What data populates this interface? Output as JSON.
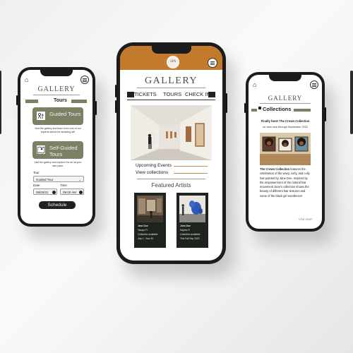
{
  "colors": {
    "olive": "#7e8064",
    "dark_green": "#1f231e",
    "rust_header": "#c47a2c",
    "accent_line": "#c98a53"
  },
  "tours_screen": {
    "gallery_title": "GALLERY",
    "section_title": "Tours",
    "guided": {
      "label": "Guided Tours",
      "icon": "tour-guide-icon",
      "caption": "Visit the gallery and learn from one of our experts about the amazing art!"
    },
    "self_guided": {
      "label": "Self-Guided Tours",
      "icon": "map-icon",
      "caption": "Visit the gallery and explore the art at your own pace."
    },
    "tour_label": "Tour",
    "tour_value": "Guided Tour",
    "date_label": "Date",
    "date_value": "08/20/22",
    "time_label": "Time",
    "time_value": "09:00 AM",
    "schedule_button": "Schedule"
  },
  "home_screen": {
    "logo_text": "SFA",
    "gallery_title": "GALLERY",
    "nav": [
      "TICKETS",
      "TOURS",
      "CHECK IN"
    ],
    "links": [
      "Upcoming Events",
      "View collections"
    ],
    "featured_title": "Featured Artists",
    "artists": [
      {
        "name": "Jane Doe",
        "location": "Tampa Fl",
        "status": "Collection available",
        "dates": "July 1 - Nov 30"
      },
      {
        "name": "John Doe",
        "location": "Naples Fl",
        "status": "Collection available",
        "dates": "This Fall Sep 2022"
      }
    ]
  },
  "collections_screen": {
    "gallery_title": "GALLERY",
    "section_title": "Collections",
    "headline": "Finally here! The Crown Collection",
    "subhead": "on view now through September 2022",
    "body_lead": "The Crown Collection",
    "body": "features the celebration of the wavy, curly, and coily hair painted by Jane Doe. Inspired by the empowerment of the natural hair movement Jane's collection shows the beauty of different hair textures and some of the black girl excellence!",
    "visit_link": "Visit now!"
  }
}
